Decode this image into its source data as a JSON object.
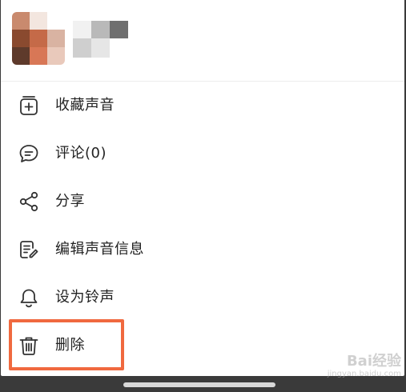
{
  "header": {
    "cover_image": "blurred-album-cover",
    "title_obscured": true
  },
  "menu": {
    "items": [
      {
        "id": "favorite",
        "label": "收藏声音",
        "icon": "add-to-collection-icon"
      },
      {
        "id": "comment",
        "label": "评论(0)",
        "icon": "comment-icon"
      },
      {
        "id": "share",
        "label": "分享",
        "icon": "share-icon"
      },
      {
        "id": "edit",
        "label": "编辑声音信息",
        "icon": "edit-document-icon"
      },
      {
        "id": "ringtone",
        "label": "设为铃声",
        "icon": "bell-icon"
      },
      {
        "id": "delete",
        "label": "删除",
        "icon": "trash-icon"
      }
    ]
  },
  "highlight": {
    "target": "delete",
    "color": "#f0693f"
  },
  "watermark": {
    "brand": "Bai经验",
    "url": "jingyan.baidu.com"
  }
}
